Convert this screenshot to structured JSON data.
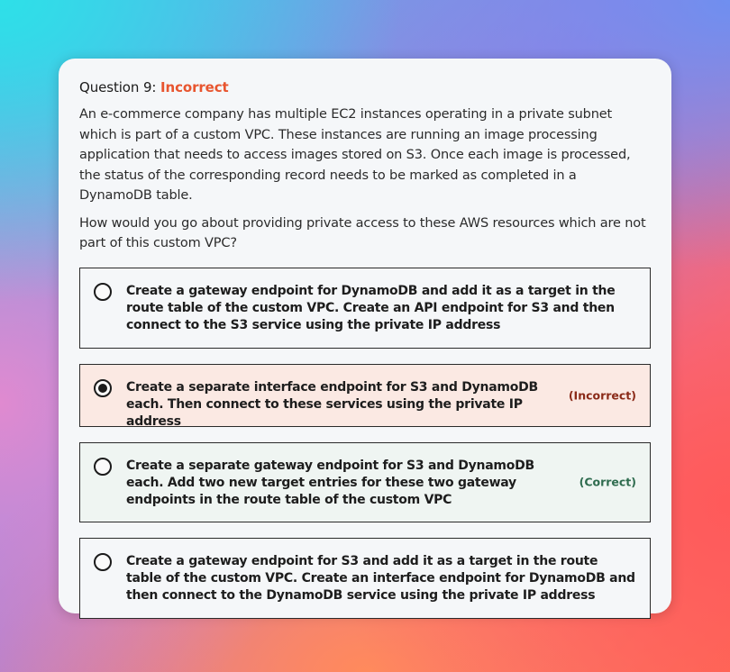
{
  "question": {
    "label": "Question 9:",
    "status": "Incorrect",
    "paragraphs": [
      "An e-commerce company has multiple EC2 instances operating in a private subnet which is part of a custom VPC. These instances are running an image processing application that needs to access images stored on S3. Once each image is processed, the status of the corresponding record needs to be marked as completed in a DynamoDB table.",
      "How would you go about providing private access to these AWS resources which are not part of this custom VPC?"
    ]
  },
  "options": [
    {
      "text": "Create a gateway endpoint for DynamoDB and add it as a target in the route table of the custom VPC. Create an API endpoint for S3 and then connect to the S3 service using the private IP address",
      "selected": false,
      "tag": ""
    },
    {
      "text": "Create a separate interface endpoint for S3 and DynamoDB each. Then connect to these services using the private IP address",
      "selected": true,
      "tag": "(Incorrect)"
    },
    {
      "text": "Create a separate gateway endpoint for S3 and DynamoDB each. Add two new target entries for these two gateway endpoints in the route table of the custom VPC",
      "selected": false,
      "tag": "(Correct)"
    },
    {
      "text": "Create a gateway endpoint for S3 and add it as a target in the route table of the custom VPC. Create an interface endpoint for DynamoDB and then connect to the DynamoDB service using the private IP address",
      "selected": false,
      "tag": ""
    }
  ],
  "colors": {
    "status_incorrect": "#e8552f",
    "incorrect_bg": "#fbe9e3",
    "correct_bg": "#eff5f2",
    "incorrect_tag": "#8a2a18",
    "correct_tag": "#2e6b4e"
  }
}
